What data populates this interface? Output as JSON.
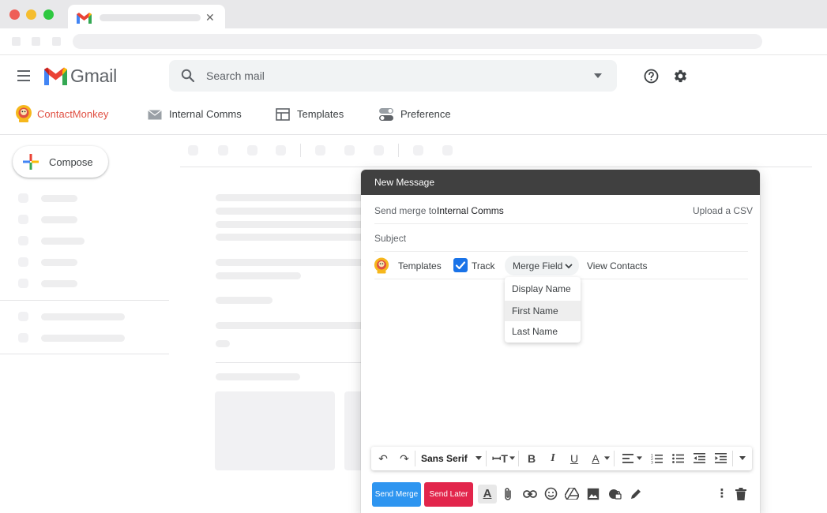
{
  "search": {
    "placeholder": "Search mail"
  },
  "gmail": {
    "brand": "Gmail"
  },
  "addon_bar": {
    "brand": "ContactMonkey",
    "items": [
      {
        "label": "Internal Comms",
        "icon": "envelope-icon"
      },
      {
        "label": "Templates",
        "icon": "layout-icon"
      },
      {
        "label": "Preference",
        "icon": "toggle-icon"
      }
    ]
  },
  "sidebar": {
    "compose_label": "Compose"
  },
  "compose": {
    "title": "New Message",
    "send_merge_to_label": "Send merge to:",
    "send_merge_to_value": "Internal Comms",
    "upload_csv": "Upload a CSV",
    "subject_label": "Subject",
    "toolbar": {
      "templates": "Templates",
      "track": "Track",
      "track_checked": true,
      "merge_field": "Merge Field",
      "view_contacts": "View Contacts"
    },
    "merge_menu": [
      "Display Name",
      "First Name",
      "Last Name"
    ],
    "merge_menu_highlighted": "First Name",
    "font_family": "Sans Serif",
    "send_merge": "Send Merge",
    "send_later": "Send Later"
  },
  "colors": {
    "send_merge": "#2e95f0",
    "send_later": "#e2254b",
    "brand_red": "#e05043",
    "checkbox": "#1a73e8"
  }
}
